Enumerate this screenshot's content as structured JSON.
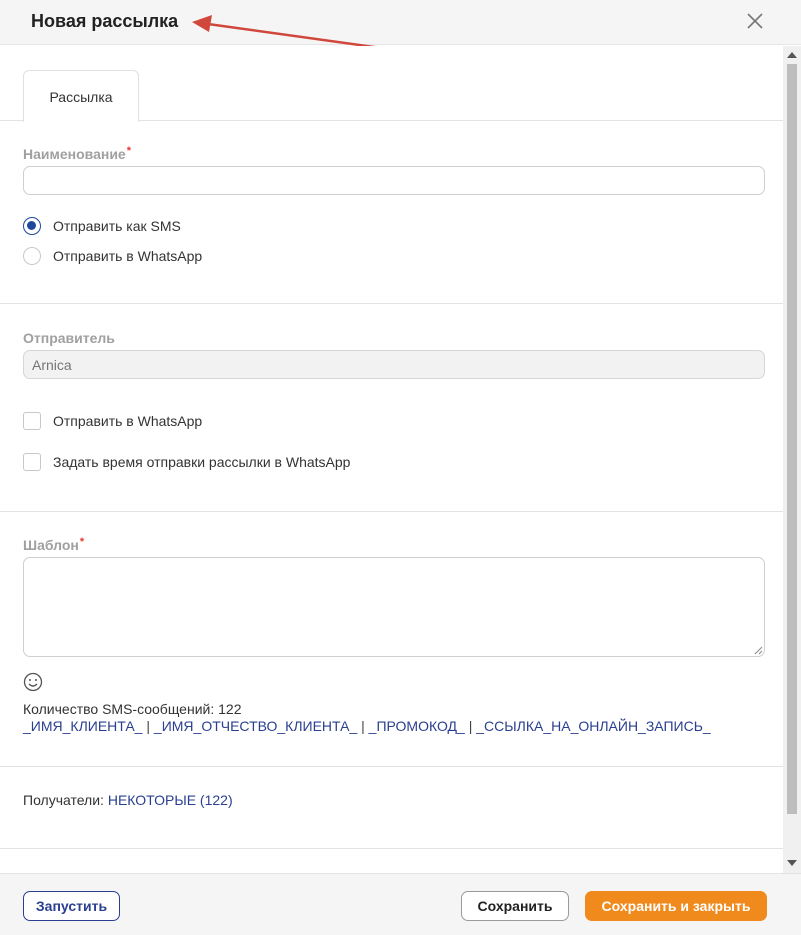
{
  "dialog": {
    "title": "Новая рассылка"
  },
  "tabs": [
    {
      "label": "Рассылка"
    }
  ],
  "form": {
    "name": {
      "label": "Наименование",
      "required_mark": "*",
      "value": ""
    },
    "send_mode": {
      "options": [
        {
          "label": "Отправить как SMS",
          "checked": true
        },
        {
          "label": "Отправить в WhatsApp",
          "checked": false
        }
      ]
    },
    "sender": {
      "label": "Отправитель",
      "placeholder": "Arnica"
    },
    "checkboxes": [
      {
        "label": "Отправить в WhatsApp",
        "checked": false
      },
      {
        "label": "Задать время отправки рассылки в WhatsApp",
        "checked": false
      }
    ],
    "template": {
      "label": "Шаблон",
      "required_mark": "*",
      "value": ""
    },
    "sms_count_text": "Количество SMS-сообщений: 122",
    "macros": [
      "_ИМЯ_КЛИЕНТА_",
      "_ИМЯ_ОТЧЕСТВО_КЛИЕНТА_",
      "_ПРОМОКОД_",
      "_ССЫЛКА_НА_ОНЛАЙН_ЗАПИСЬ_"
    ],
    "macro_separator": "|",
    "recipients": {
      "label": "Получатели:",
      "value": "НЕКОТОРЫЕ (122)"
    }
  },
  "footer": {
    "launch": "Запустить",
    "save": "Сохранить",
    "save_close": "Сохранить и закрыть"
  },
  "colors": {
    "accent": "#2a3f8f",
    "primary_button": "#f08a1c",
    "required": "#e53935",
    "annotation_arrow": "#d0473c"
  },
  "icons": {
    "close": "close-icon",
    "emoji": "smiley-icon",
    "annotation": "arrow-annotation"
  }
}
